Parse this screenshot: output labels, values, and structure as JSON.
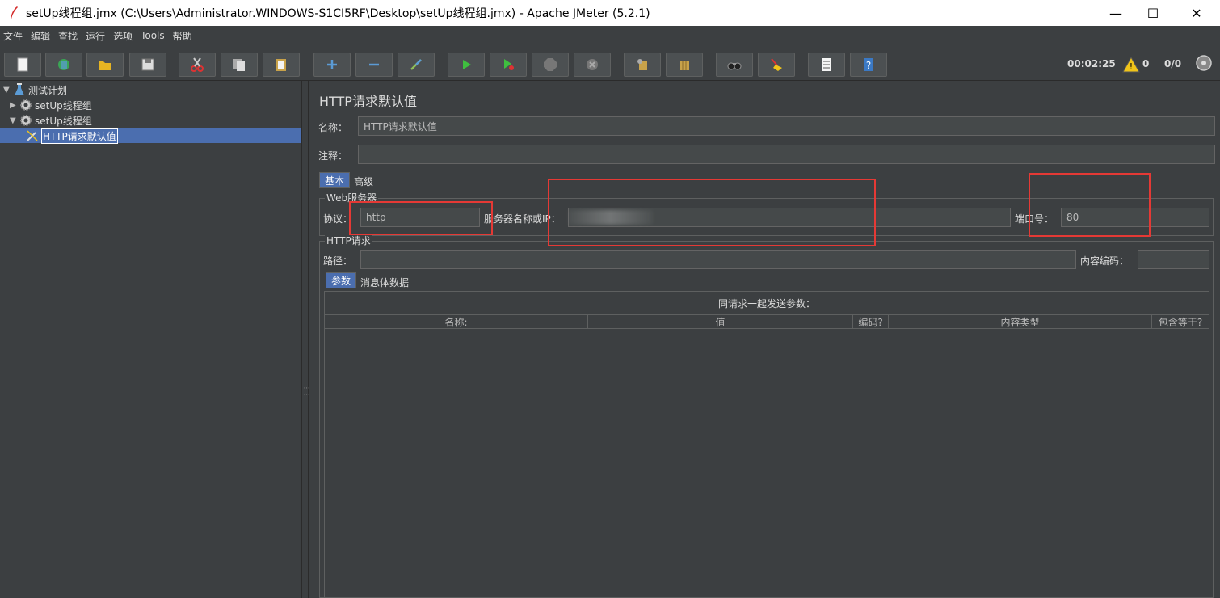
{
  "window": {
    "title": "setUp线程组.jmx (C:\\Users\\Administrator.WINDOWS-S1CI5RF\\Desktop\\setUp线程组.jmx) - Apache JMeter (5.2.1)",
    "minimize": "—",
    "maximize": "☐",
    "close": "✕"
  },
  "menu": [
    "文件",
    "编辑",
    "查找",
    "运行",
    "选项",
    "Tools",
    "帮助"
  ],
  "toolbar": {
    "timer": "00:02:25",
    "warnings": "0",
    "threads": "0/0"
  },
  "tree": {
    "items": [
      {
        "label": "测试计划",
        "icon": "flask-icon"
      },
      {
        "label": "setUp线程组",
        "icon": "gear-icon"
      },
      {
        "label": "setUp线程组",
        "icon": "gear-icon"
      },
      {
        "label": "HTTP请求默认值",
        "icon": "wrench-icon"
      }
    ]
  },
  "panel": {
    "heading": "HTTP请求默认值",
    "name_label": "名称：",
    "name_value": "HTTP请求默认值",
    "comment_label": "注释：",
    "comment_value": "",
    "tabs": [
      "基本",
      "高级"
    ],
    "web_server": {
      "group_title": "Web服务器",
      "protocol_label": "协议：",
      "protocol_value": "http",
      "server_label": "服务器名称或IP：",
      "server_value": "",
      "port_label": "端口号：",
      "port_value": "80"
    },
    "http_request": {
      "group_title": "HTTP请求",
      "path_label": "路径：",
      "path_value": "",
      "encoding_label": "内容编码：",
      "encoding_value": ""
    },
    "sub_tabs": [
      "参数",
      "消息体数据"
    ],
    "params_caption": "同请求一起发送参数：",
    "columns": [
      "名称:",
      "值",
      "编码?",
      "内容类型",
      "包含等于?"
    ]
  },
  "colors": {
    "background": "#3c3f41",
    "selection": "#4b6eaf",
    "highlight_box": "#e53935"
  }
}
